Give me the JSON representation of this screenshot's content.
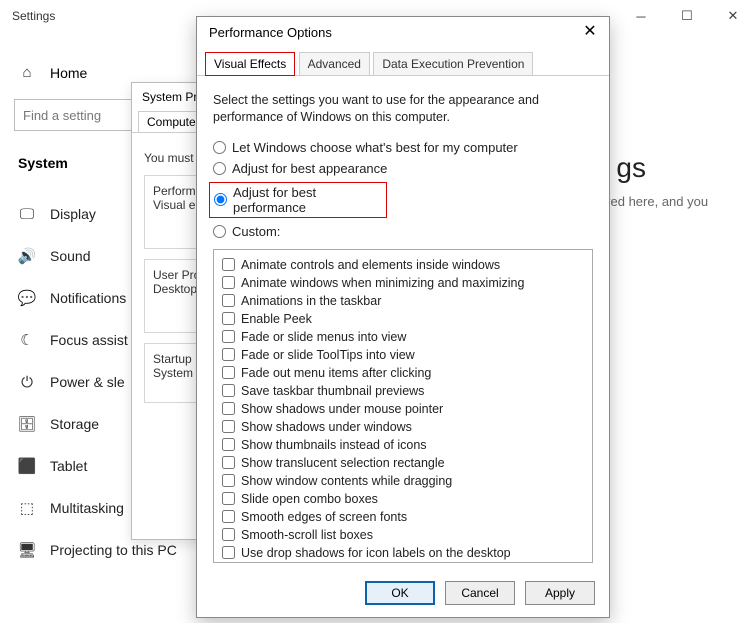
{
  "settings": {
    "title": "Settings",
    "home": "Home",
    "search_placeholder": "Find a setting",
    "group": "System",
    "items": [
      {
        "icon": "🖵",
        "label": "Display"
      },
      {
        "icon": "🔊",
        "label": "Sound"
      },
      {
        "icon": "💬",
        "label": "Notifications"
      },
      {
        "icon": "☾",
        "label": "Focus assist"
      },
      {
        "icon": "⏻",
        "label": "Power & sle"
      },
      {
        "icon": "🗄",
        "label": "Storage"
      },
      {
        "icon": "⬛",
        "label": "Tablet"
      },
      {
        "icon": "⬚",
        "label": "Multitasking"
      },
      {
        "icon": "🖥",
        "label": "Projecting to this PC"
      }
    ],
    "partial_heading": "gs",
    "partial_text": "ved here, and you"
  },
  "sysprops": {
    "title": "System Pro",
    "tab": "Computer N",
    "line1": "You must",
    "sec1a": "Performa",
    "sec1b": "Visual e",
    "sec2a": "User Pro",
    "sec2b": "Desktop",
    "sec3a": "Startup",
    "sec3b": "System"
  },
  "perfopt": {
    "title": "Performance Options",
    "tabs": [
      "Visual Effects",
      "Advanced",
      "Data Execution Prevention"
    ],
    "desc": "Select the settings you want to use for the appearance and performance of Windows on this computer.",
    "radios": [
      "Let Windows choose what's best for my computer",
      "Adjust for best appearance",
      "Adjust for best performance",
      "Custom:"
    ],
    "selected_radio": 2,
    "checks": [
      "Animate controls and elements inside windows",
      "Animate windows when minimizing and maximizing",
      "Animations in the taskbar",
      "Enable Peek",
      "Fade or slide menus into view",
      "Fade or slide ToolTips into view",
      "Fade out menu items after clicking",
      "Save taskbar thumbnail previews",
      "Show shadows under mouse pointer",
      "Show shadows under windows",
      "Show thumbnails instead of icons",
      "Show translucent selection rectangle",
      "Show window contents while dragging",
      "Slide open combo boxes",
      "Smooth edges of screen fonts",
      "Smooth-scroll list boxes",
      "Use drop shadows for icon labels on the desktop"
    ],
    "buttons": {
      "ok": "OK",
      "cancel": "Cancel",
      "apply": "Apply"
    }
  }
}
